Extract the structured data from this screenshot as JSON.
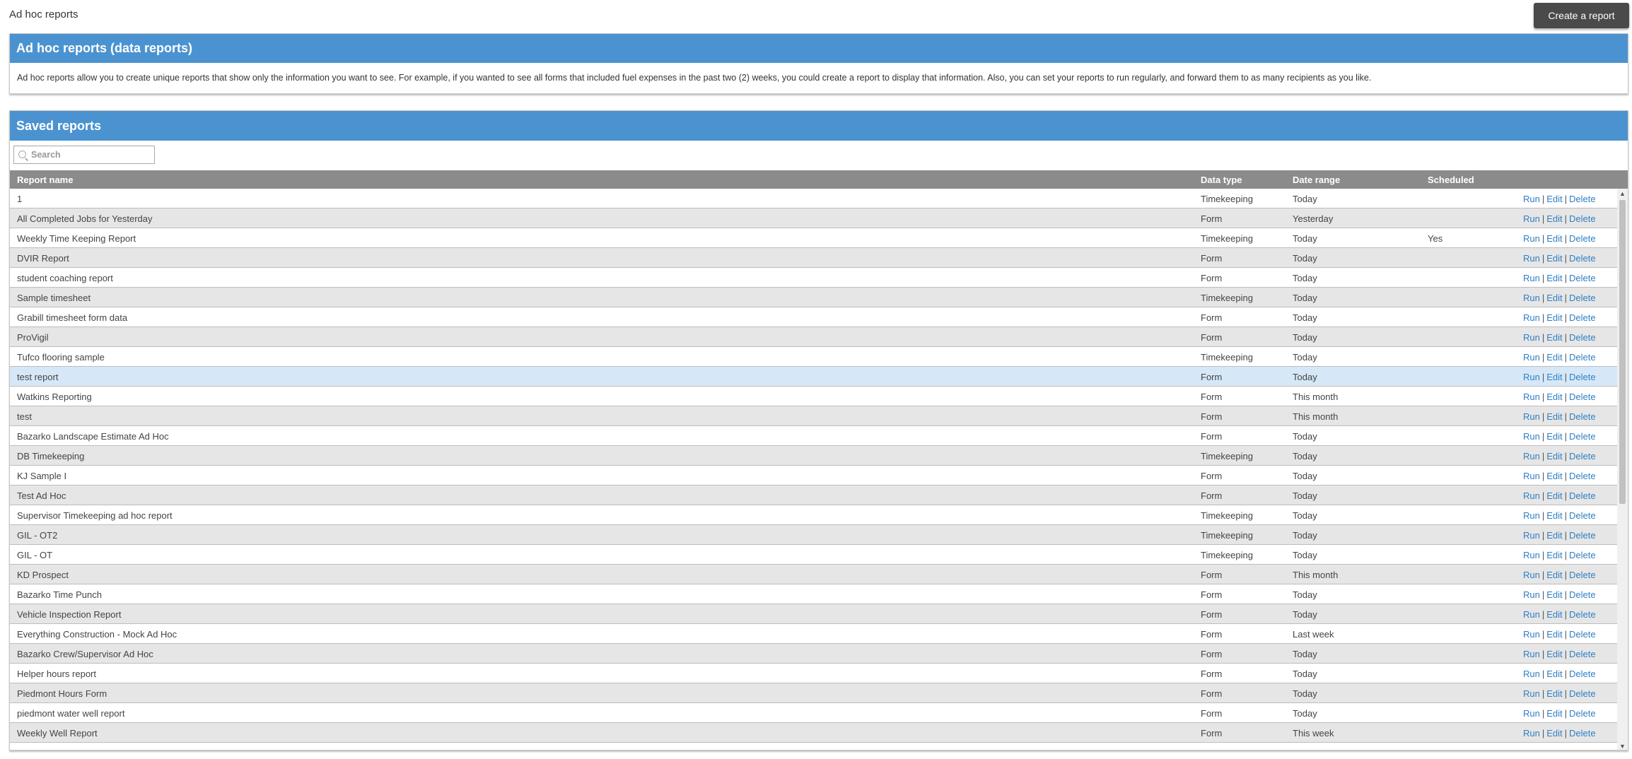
{
  "header": {
    "title": "Ad hoc reports",
    "create_label": "Create a report"
  },
  "intro": {
    "title": "Ad hoc reports (data reports)",
    "text": "Ad hoc reports allow you to create unique reports that show only the information you want to see. For example, if you wanted to see all forms that included fuel expenses in the past two (2) weeks, you could create a report to display that information. Also, you can set your reports to run regularly, and forward them to as many recipients as you like."
  },
  "saved": {
    "title": "Saved reports",
    "search_placeholder": "Search",
    "columns": {
      "name": "Report name",
      "type": "Data type",
      "range": "Date range",
      "scheduled": "Scheduled"
    },
    "actions": {
      "run": "Run",
      "edit": "Edit",
      "delete": "Delete",
      "sep": "|"
    },
    "rows": [
      {
        "name": "1",
        "type": "Timekeeping",
        "range": "Today",
        "scheduled": ""
      },
      {
        "name": "All Completed Jobs for Yesterday",
        "type": "Form",
        "range": "Yesterday",
        "scheduled": ""
      },
      {
        "name": "Weekly Time Keeping Report",
        "type": "Timekeeping",
        "range": "Today",
        "scheduled": "Yes"
      },
      {
        "name": "DVIR Report",
        "type": "Form",
        "range": "Today",
        "scheduled": ""
      },
      {
        "name": "student coaching report",
        "type": "Form",
        "range": "Today",
        "scheduled": ""
      },
      {
        "name": "Sample timesheet",
        "type": "Timekeeping",
        "range": "Today",
        "scheduled": ""
      },
      {
        "name": "Grabill timesheet form data",
        "type": "Form",
        "range": "Today",
        "scheduled": ""
      },
      {
        "name": "ProVigil",
        "type": "Form",
        "range": "Today",
        "scheduled": ""
      },
      {
        "name": "Tufco flooring sample",
        "type": "Timekeeping",
        "range": "Today",
        "scheduled": ""
      },
      {
        "name": "test report",
        "type": "Form",
        "range": "Today",
        "scheduled": ""
      },
      {
        "name": "Watkins Reporting",
        "type": "Form",
        "range": "This month",
        "scheduled": ""
      },
      {
        "name": "test",
        "type": "Form",
        "range": "This month",
        "scheduled": ""
      },
      {
        "name": "Bazarko Landscape Estimate Ad Hoc",
        "type": "Form",
        "range": "Today",
        "scheduled": ""
      },
      {
        "name": "DB Timekeeping",
        "type": "Timekeeping",
        "range": "Today",
        "scheduled": ""
      },
      {
        "name": "KJ Sample I",
        "type": "Form",
        "range": "Today",
        "scheduled": ""
      },
      {
        "name": "Test Ad Hoc",
        "type": "Form",
        "range": "Today",
        "scheduled": ""
      },
      {
        "name": "Supervisor Timekeeping ad hoc report",
        "type": "Timekeeping",
        "range": "Today",
        "scheduled": ""
      },
      {
        "name": "GIL - OT2",
        "type": "Timekeeping",
        "range": "Today",
        "scheduled": ""
      },
      {
        "name": "GIL - OT",
        "type": "Timekeeping",
        "range": "Today",
        "scheduled": ""
      },
      {
        "name": "KD Prospect",
        "type": "Form",
        "range": "This month",
        "scheduled": ""
      },
      {
        "name": "Bazarko Time Punch",
        "type": "Form",
        "range": "Today",
        "scheduled": ""
      },
      {
        "name": "Vehicle Inspection Report",
        "type": "Form",
        "range": "Today",
        "scheduled": ""
      },
      {
        "name": "Everything Construction - Mock Ad Hoc",
        "type": "Form",
        "range": "Last week",
        "scheduled": ""
      },
      {
        "name": "Bazarko Crew/Supervisor Ad Hoc",
        "type": "Form",
        "range": "Today",
        "scheduled": ""
      },
      {
        "name": "Helper hours report",
        "type": "Form",
        "range": "Today",
        "scheduled": ""
      },
      {
        "name": "Piedmont Hours Form",
        "type": "Form",
        "range": "Today",
        "scheduled": ""
      },
      {
        "name": "piedmont water well report",
        "type": "Form",
        "range": "Today",
        "scheduled": ""
      },
      {
        "name": "Weekly Well Report",
        "type": "Form",
        "range": "This week",
        "scheduled": ""
      }
    ],
    "selected_row": 9
  },
  "icons": {
    "search": "search-icon",
    "scroll_up": "scroll-up-arrow-icon",
    "scroll_down": "scroll-down-arrow-icon"
  },
  "colors": {
    "panel_header": "#4b93d0",
    "table_header": "#8b8b8b",
    "link": "#2e7fc4",
    "selected_row": "#d6e8f7"
  }
}
